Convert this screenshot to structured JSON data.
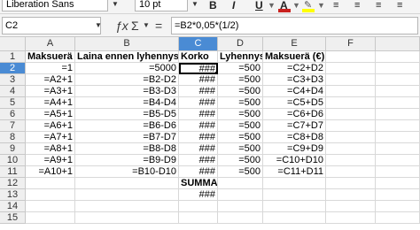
{
  "toolbar": {
    "font_name": "Liberation Sans",
    "font_size": "10 pt",
    "buttons": [
      "B",
      "I",
      "U",
      "A"
    ],
    "font_color": "#c9211e",
    "highlight_color": "#ffff00"
  },
  "formula_bar": {
    "cell_ref": "C2",
    "fx_icon": "ƒx",
    "sum_icon": "Σ",
    "equals_icon": "=",
    "formula": "=B2*0,05*(1/2)"
  },
  "columns": [
    "A",
    "B",
    "C",
    "D",
    "E",
    "F"
  ],
  "selected_column": "C",
  "selected_row": "2",
  "rows": [
    {
      "n": "1",
      "cells": [
        "Maksuerä",
        "Laina ennen lyhennystä",
        "Korko",
        "Lyhennys",
        "Maksuerä (€)",
        ""
      ]
    },
    {
      "n": "2",
      "cells": [
        "=1",
        "=5000",
        "###",
        "=500",
        "=C2+D2",
        ""
      ]
    },
    {
      "n": "3",
      "cells": [
        "=A2+1",
        "=B2-D2",
        "###",
        "=500",
        "=C3+D3",
        ""
      ]
    },
    {
      "n": "4",
      "cells": [
        "=A3+1",
        "=B3-D3",
        "###",
        "=500",
        "=C4+D4",
        ""
      ]
    },
    {
      "n": "5",
      "cells": [
        "=A4+1",
        "=B4-D4",
        "###",
        "=500",
        "=C5+D5",
        ""
      ]
    },
    {
      "n": "6",
      "cells": [
        "=A5+1",
        "=B5-D5",
        "###",
        "=500",
        "=C6+D6",
        ""
      ]
    },
    {
      "n": "7",
      "cells": [
        "=A6+1",
        "=B6-D6",
        "###",
        "=500",
        "=C7+D7",
        ""
      ]
    },
    {
      "n": "8",
      "cells": [
        "=A7+1",
        "=B7-D7",
        "###",
        "=500",
        "=C8+D8",
        ""
      ]
    },
    {
      "n": "9",
      "cells": [
        "=A8+1",
        "=B8-D8",
        "###",
        "=500",
        "=C9+D9",
        ""
      ]
    },
    {
      "n": "10",
      "cells": [
        "=A9+1",
        "=B9-D9",
        "###",
        "=500",
        "=C10+D10",
        ""
      ]
    },
    {
      "n": "11",
      "cells": [
        "=A10+1",
        "=B10-D10",
        "###",
        "=500",
        "=C11+D11",
        ""
      ]
    },
    {
      "n": "12",
      "cells": [
        "",
        "",
        "SUMMA:",
        "",
        "",
        ""
      ]
    },
    {
      "n": "13",
      "cells": [
        "",
        "",
        "###",
        "",
        "",
        ""
      ]
    },
    {
      "n": "14",
      "cells": [
        "",
        "",
        "",
        "",
        "",
        ""
      ]
    },
    {
      "n": "15",
      "cells": [
        "",
        "",
        "",
        "",
        "",
        ""
      ]
    }
  ]
}
